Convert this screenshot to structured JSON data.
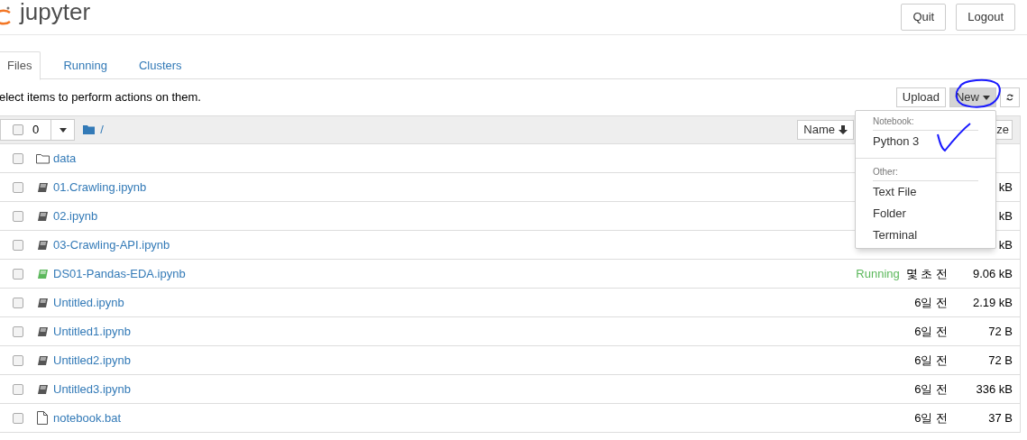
{
  "header": {
    "logo_text": "jupyter",
    "buttons": [
      "Quit",
      "Logout"
    ]
  },
  "tabs": [
    {
      "label": "Files",
      "selected": true
    },
    {
      "label": "Running",
      "selected": false
    },
    {
      "label": "Clusters",
      "selected": false
    }
  ],
  "hint": "elect items to perform actions on them.",
  "toolbar": [
    {
      "kind": "text",
      "label": "Upload",
      "pressed": false
    },
    {
      "kind": "dropdown",
      "label": "New",
      "pressed": true
    },
    {
      "kind": "refresh",
      "pressed": false
    }
  ],
  "list_header": {
    "checked": false,
    "selected_count": "0",
    "path": "/",
    "sort_buttons": [
      {
        "label": "Name",
        "arrow": true
      },
      {
        "label": "ze",
        "arrow": false
      }
    ]
  },
  "files": [
    {
      "name": "data",
      "kind": "folder",
      "checked": false
    },
    {
      "name": "01.Crawling.ipynb",
      "kind": "notebook",
      "checked": false,
      "running": false,
      "size": "kB"
    },
    {
      "name": "02.ipynb",
      "kind": "notebook",
      "checked": false,
      "running": false,
      "size": "kB"
    },
    {
      "name": "03-Crawling-API.ipynb",
      "kind": "notebook",
      "checked": false,
      "running": false,
      "size": "kB"
    },
    {
      "name": "DS01-Pandas-EDA.ipynb",
      "kind": "notebook",
      "checked": false,
      "running": true,
      "status": "Running",
      "modified": "몇 초 전",
      "size": "9.06 kB"
    },
    {
      "name": "Untitled.ipynb",
      "kind": "notebook",
      "checked": false,
      "running": false,
      "modified": "6일 전",
      "size": "2.19 kB"
    },
    {
      "name": "Untitled1.ipynb",
      "kind": "notebook",
      "checked": false,
      "running": false,
      "modified": "6일 전",
      "size": "72 B"
    },
    {
      "name": "Untitled2.ipynb",
      "kind": "notebook",
      "checked": false,
      "running": false,
      "modified": "6일 전",
      "size": "72 B"
    },
    {
      "name": "Untitled3.ipynb",
      "kind": "notebook",
      "checked": false,
      "running": false,
      "modified": "6일 전",
      "size": "336 kB"
    },
    {
      "name": "notebook.bat",
      "kind": "file",
      "checked": false,
      "modified": "6일 전",
      "size": "37 B"
    }
  ],
  "new_menu": {
    "open": true,
    "sections": [
      {
        "header": "Notebook:",
        "items": [
          "Python 3"
        ]
      },
      {
        "header": "Other:",
        "items": [
          "Text File",
          "Folder",
          "Terminal"
        ]
      }
    ]
  }
}
